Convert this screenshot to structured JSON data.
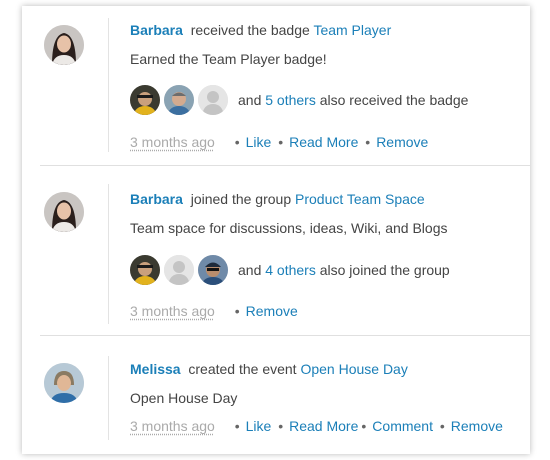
{
  "feed": [
    {
      "actor": "Barbara",
      "action": "received the badge",
      "target": "Team Player",
      "body": "Earned the Team Player badge!",
      "others_prefix": "and",
      "others_link": "5 others",
      "others_suffix": "also received the badge",
      "time": "3 months ago",
      "actions": [
        "Like",
        "Read More",
        "Remove"
      ]
    },
    {
      "actor": "Barbara",
      "action": "joined the group",
      "target": "Product Team Space",
      "body": "Team space for discussions, ideas, Wiki, and Blogs",
      "others_prefix": "and",
      "others_link": "4 others",
      "others_suffix": "also joined the group",
      "time": "3 months ago",
      "actions": [
        "Remove"
      ]
    },
    {
      "actor": "Melissa",
      "action": "created the event",
      "target": "Open House Day",
      "body": "Open House Day",
      "time": "3 months ago",
      "actions": [
        "Like",
        "Read More",
        "Comment",
        "Remove"
      ]
    }
  ],
  "colors": {
    "link": "#1b7fb8",
    "meta": "#999999"
  }
}
